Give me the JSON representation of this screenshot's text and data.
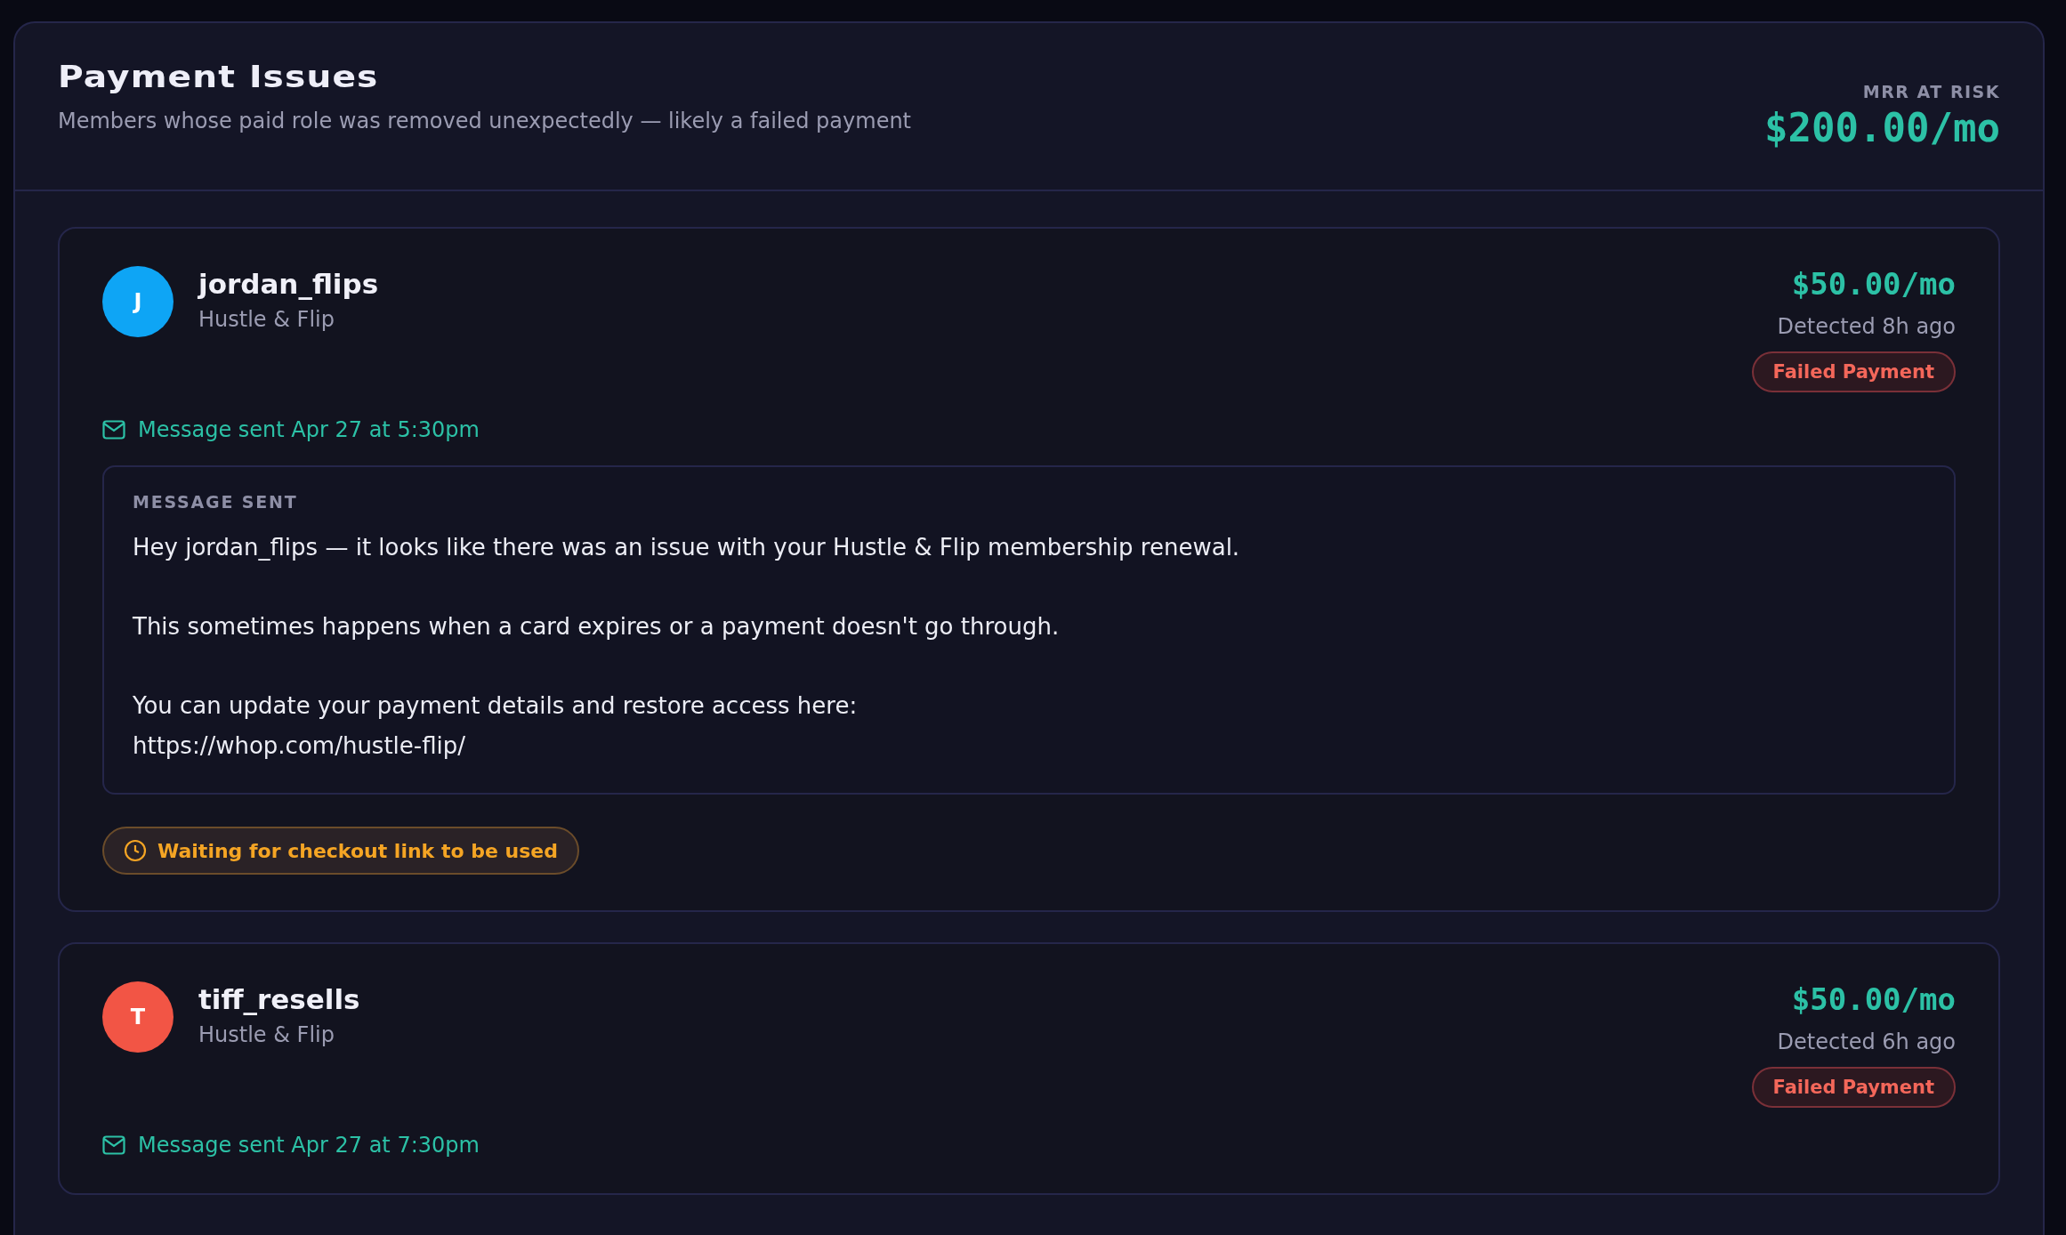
{
  "header": {
    "title": "Payment Issues",
    "subtitle": "Members whose paid role was removed unexpectedly — likely a failed payment",
    "mrr_label": "MRR AT RISK",
    "mrr_value": "$200.00/mo"
  },
  "members": [
    {
      "initial": "J",
      "color": "#0ea5f5",
      "username": "jordan_flips",
      "community": "Hustle & Flip",
      "amount": "$50.00/mo",
      "detected": "Detected 8h ago",
      "badge": {
        "kind": "failed",
        "label": "Failed Payment"
      },
      "message_status": "Message sent Apr 27 at 5:30pm",
      "message": {
        "heading": "MESSAGE SENT",
        "paragraphs": [
          [
            "Hey jordan_flips — it looks like there was an issue with your Hustle & Flip membership renewal."
          ],
          [
            "This sometimes happens when a card expires or a payment doesn't go through."
          ],
          [
            "You can update your payment details and restore access here:",
            "https://whop.com/hustle-flip/"
          ]
        ]
      },
      "status": {
        "kind": "waiting",
        "label": "Waiting for checkout link to be used"
      }
    },
    {
      "initial": "T",
      "color": "#f25545",
      "username": "tiff_resells",
      "community": "Hustle & Flip",
      "amount": "$50.00/mo",
      "detected": "Detected 6h ago",
      "badge": {
        "kind": "failed",
        "label": "Failed Payment"
      },
      "message_status": "Message sent Apr 27 at 7:30pm"
    }
  ]
}
